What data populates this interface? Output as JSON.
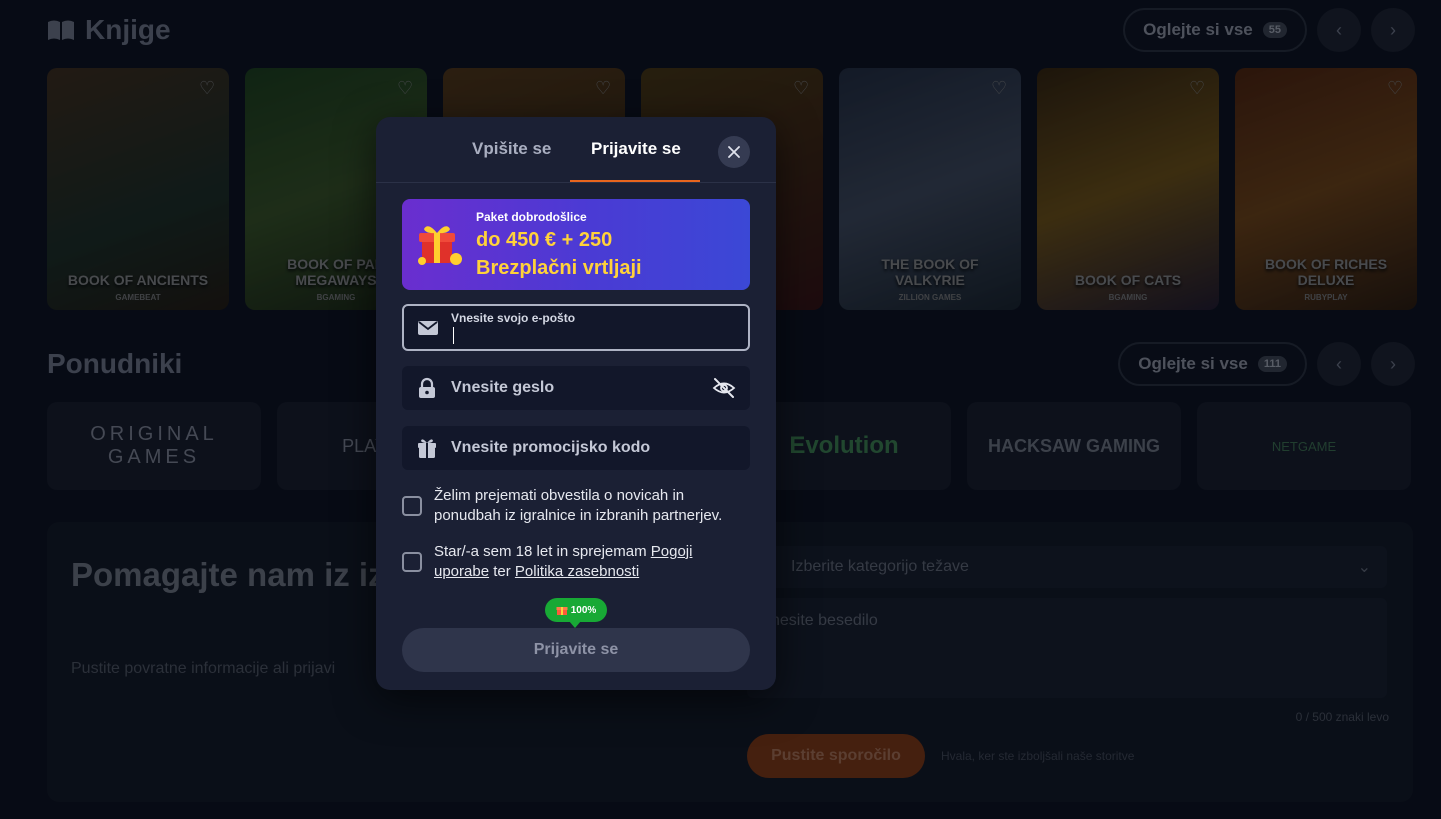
{
  "books_section": {
    "title": "Knjige",
    "see_all_label": "Oglejte si vse",
    "see_all_count": "55",
    "games": [
      {
        "title": "BOOK OF ANCIENTS",
        "provider": "GAMEBEAT"
      },
      {
        "title": "BOOK OF PAN MEGAWAYS",
        "provider": "BGAMING"
      },
      {
        "title": "",
        "provider": ""
      },
      {
        "title": "",
        "provider": ""
      },
      {
        "title": "THE BOOK OF VALKYRIE",
        "provider": "ZILLION GAMES"
      },
      {
        "title": "BOOK OF CATS",
        "provider": "BGAMING"
      },
      {
        "title": "BOOK OF RICHES DELUXE",
        "provider": "RUBYPLAY"
      }
    ]
  },
  "providers_section": {
    "title": "Ponudniki",
    "see_all_label": "Oglejte si vse",
    "see_all_count": "111",
    "providers": [
      "ORIGINAL GAMES",
      "PLAYSON",
      "",
      "Evolution",
      "HACKSAW GAMING",
      "NETGAME"
    ]
  },
  "feedback": {
    "title": "Pomagajte nam iz izkušnjo",
    "subtitle": "Pustite povratne informacije ali prijavi",
    "select_placeholder": "Izberite kategorijo težave",
    "textarea_placeholder": "nesite besedilo",
    "counter": "0 / 500 znaki levo",
    "send_label": "Pustite sporočilo",
    "thanks": "Hvala, ker ste izboljšali naše storitve"
  },
  "modal": {
    "tabs": {
      "signup": "Vpišite se",
      "login": "Prijavite se"
    },
    "bonus": {
      "label": "Paket dobrodošlice",
      "amount": "do 450 € + 250",
      "spins": "Brezplačni vrtljaji"
    },
    "email_label": "Vnesite svojo e-pošto",
    "password_placeholder": "Vnesite geslo",
    "promo_placeholder": "Vnesite promocijsko kodo",
    "newsletter_text": "Želim prejemati obvestila o novicah in ponudbah iz igralnice in izbranih partnerjev.",
    "terms_prefix": "Star/-a sem 18 let in sprejemam",
    "terms_link": "Pogoji uporabe",
    "terms_middle": "ter",
    "privacy_link": "Politika zasebnosti",
    "progress_badge": "100%",
    "submit_label": "Prijavite se"
  },
  "colors": {
    "accent": "#e8651e",
    "modal_bg": "#1b2034",
    "bonus_gold": "#ffd23a",
    "badge_green": "#18a935"
  }
}
